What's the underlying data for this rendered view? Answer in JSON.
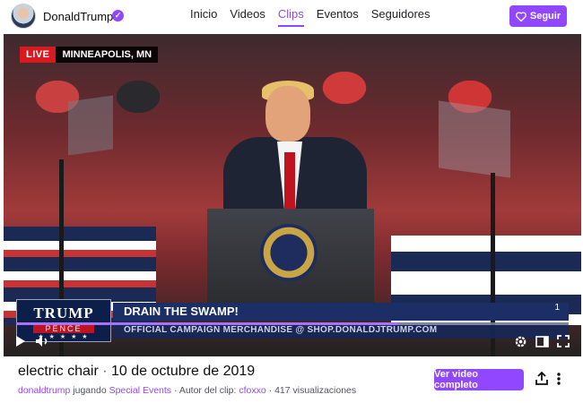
{
  "header": {
    "channel_name": "DonaldTrump",
    "verified_icon": "verified-check-icon",
    "nav": [
      {
        "label": "Inicio",
        "active": false
      },
      {
        "label": "Videos",
        "active": false
      },
      {
        "label": "Clips",
        "active": true
      },
      {
        "label": "Eventos",
        "active": false
      },
      {
        "label": "Seguidores",
        "active": false
      }
    ],
    "follow_label": "Seguir",
    "follow_icon": "heart-icon"
  },
  "video": {
    "live_label": "LIVE",
    "location": "MINNEAPOLIS, MN",
    "logo_line1": "TRUMP",
    "logo_line2": "PENCE",
    "logo_stars": "★ ★ ★ ★ ★",
    "headline": "DRAIN THE SWAMP!",
    "subline": "OFFICIAL CAMPAIGN MERCHANDISE @ SHOP.DONALDJTRUMP.COM",
    "corner_number": "1",
    "progress_fraction": 0.69,
    "controls": [
      "play-icon",
      "volume-icon",
      "settings-gear-icon",
      "theater-mode-icon",
      "fullscreen-icon"
    ]
  },
  "clip": {
    "title": "electric chair",
    "date": "10 de octubre de 2019",
    "broadcaster": "donaldtrump",
    "playing_word": "jugando",
    "category": "Special Events",
    "author_label": "Autor del clip:",
    "author": "cfoxxo",
    "views": "417 visualizaciones",
    "watch_full_label": "Ver video completo"
  },
  "colors": {
    "accent": "#9147ff",
    "live_red": "#d71920"
  }
}
